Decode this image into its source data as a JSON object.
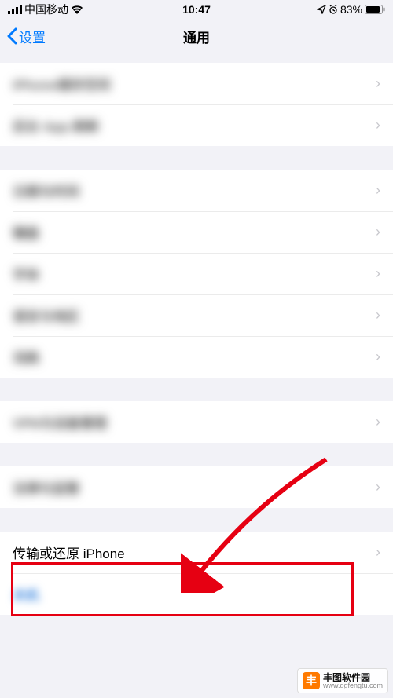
{
  "statusBar": {
    "carrier": "中国移动",
    "time": "10:47",
    "batteryPct": "83%"
  },
  "nav": {
    "back": "设置",
    "title": "通用"
  },
  "highlighted": {
    "label": "传输或还原 iPhone"
  },
  "watermark": {
    "name": "丰图软件园",
    "url": "www.dgfengtu.com",
    "logo": "丰"
  }
}
